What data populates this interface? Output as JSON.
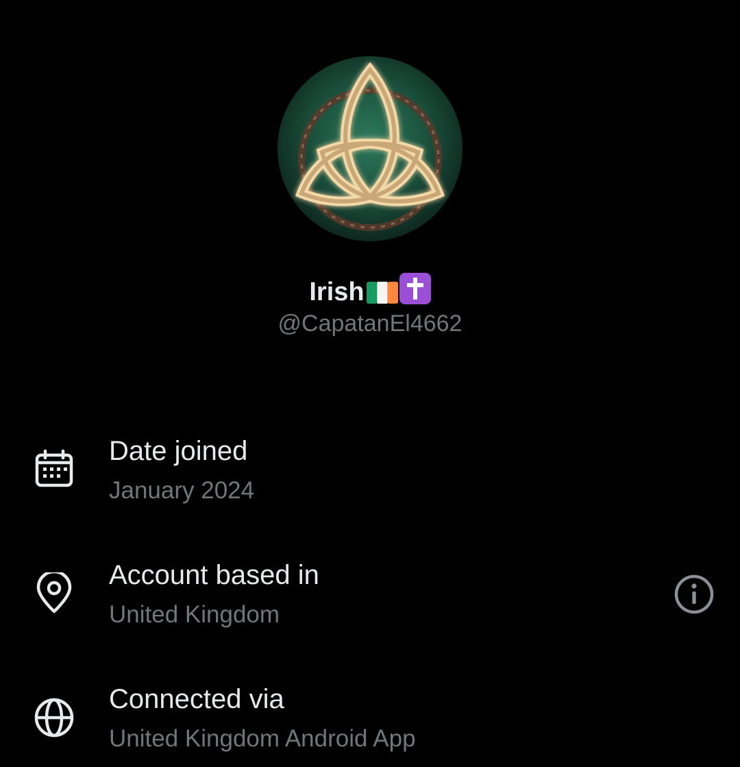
{
  "profile": {
    "display_name": "Irish",
    "name_emojis": [
      "flag-ireland",
      "latin-cross"
    ],
    "handle": "@CapatanEl4662",
    "avatar": "celtic-trinity-knot-avatar"
  },
  "about": {
    "rows": [
      {
        "icon": "calendar-icon",
        "label": "Date joined",
        "value": "January 2024"
      },
      {
        "icon": "location-pin-icon",
        "label": "Account based in",
        "value": "United Kingdom",
        "action_icon": "info-icon"
      },
      {
        "icon": "globe-icon",
        "label": "Connected via",
        "value": "United Kingdom Android App"
      }
    ]
  },
  "colors": {
    "background": "#000000",
    "primary_text": "#e7e9ea",
    "secondary_text": "#71767b",
    "avatar_green": "#1f5b45"
  }
}
